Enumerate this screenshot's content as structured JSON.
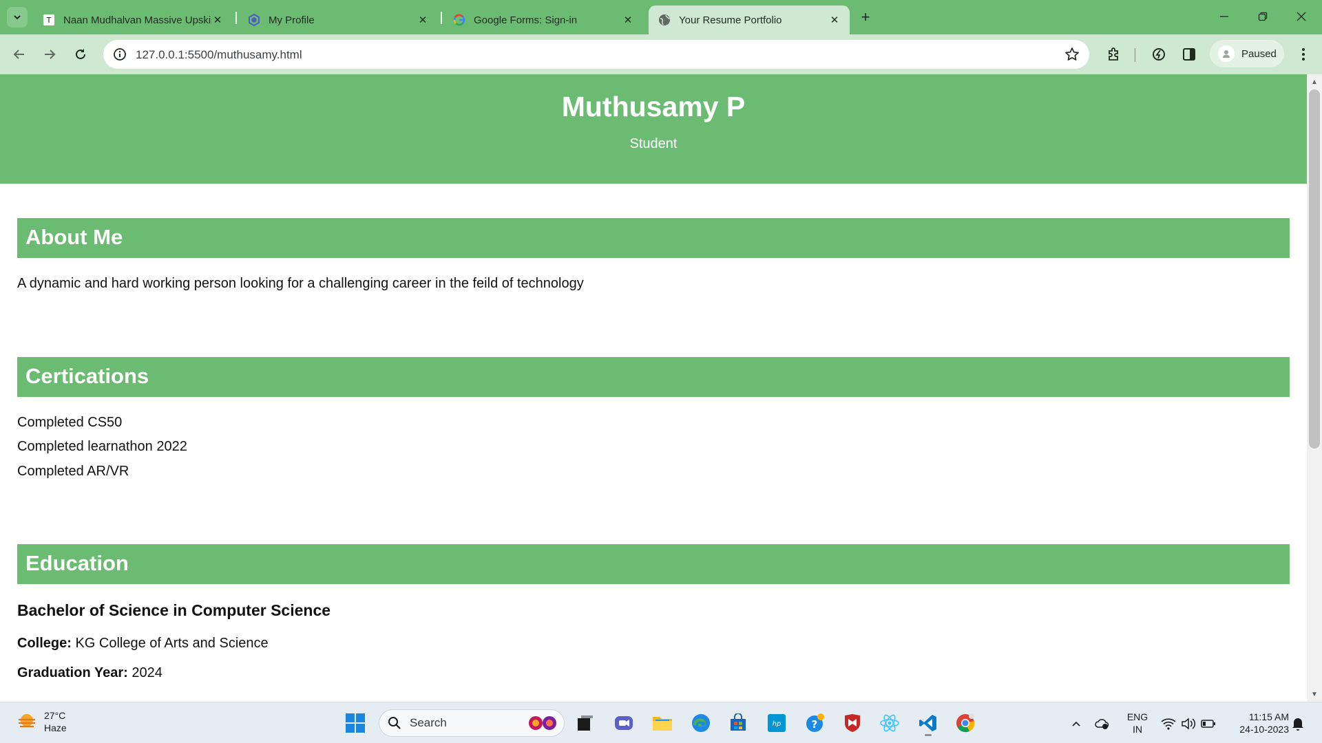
{
  "browser": {
    "tabs": [
      {
        "title": "Naan Mudhalvan Massive Upskilling",
        "favicon": "naan-mudhalvan-favicon",
        "active": false
      },
      {
        "title": "My Profile",
        "favicon": "profile-favicon",
        "active": false
      },
      {
        "title": "Google Forms: Sign-in",
        "favicon": "google-favicon",
        "active": false
      },
      {
        "title": "Your Resume Portfolio",
        "favicon": "globe-favicon",
        "active": true
      }
    ],
    "url": "127.0.0.1:5500/muthusamy.html",
    "profile_status": "Paused"
  },
  "page": {
    "header": {
      "name": "Muthusamy P",
      "role": "Student"
    },
    "about": {
      "heading": "About Me",
      "text": "A dynamic and hard working person looking for a challenging career in the feild of technology"
    },
    "certifications": {
      "heading": "Certications",
      "items": [
        "Completed CS50",
        "Completed learnathon 2022",
        "Completed AR/VR"
      ]
    },
    "education": {
      "heading": "Education",
      "degree": "Bachelor of Science in Computer Science",
      "college_label": "College:",
      "college_value": "KG College of Arts and Science",
      "grad_label": "Graduation Year:",
      "grad_value": "2024"
    }
  },
  "taskbar": {
    "weather_temp": "27°C",
    "weather_desc": "Haze",
    "search_placeholder": "Search",
    "lang_line1": "ENG",
    "lang_line2": "IN",
    "time": "11:15 AM",
    "date": "24-10-2023"
  },
  "colors": {
    "accent": "#6cbb73",
    "chrome_light": "#cfe8d1"
  }
}
